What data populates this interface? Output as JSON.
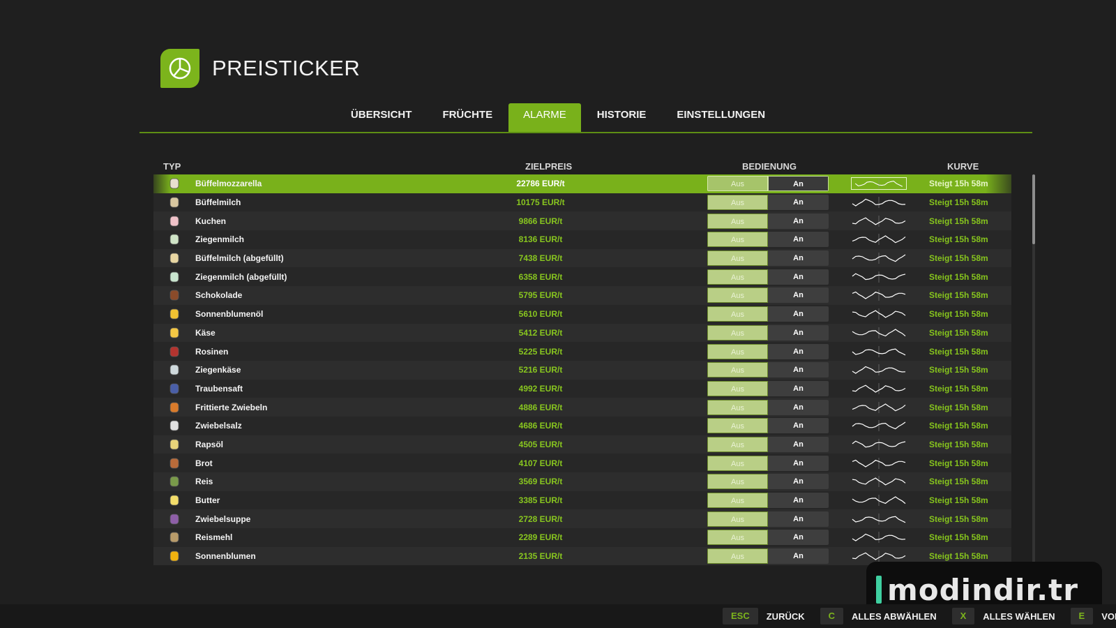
{
  "app": {
    "title": "PREISTICKER",
    "logo_icon": "pie-chart-icon",
    "accent": "#7cb41c"
  },
  "tabs": [
    {
      "label": "ÜBERSICHT",
      "active": false
    },
    {
      "label": "FRÜCHTE",
      "active": false
    },
    {
      "label": "ALARME",
      "active": true
    },
    {
      "label": "HISTORIE",
      "active": false
    },
    {
      "label": "EINSTELLUNGEN",
      "active": false
    }
  ],
  "columns": {
    "type": "TYP",
    "target": "ZIELPREIS",
    "control": "BEDIENUNG",
    "curve": "KURVE"
  },
  "rows": [
    {
      "icon": "mozzarella-icon",
      "name": "Büffelmozzarella",
      "price": "22786 EUR/t",
      "off": "Aus",
      "on": "An",
      "status": "Steigt 15h 58m",
      "selected": true
    },
    {
      "icon": "milk-bottle-icon",
      "name": "Büffelmilch",
      "price": "10175 EUR/t",
      "off": "Aus",
      "on": "An",
      "status": "Steigt 15h 58m"
    },
    {
      "icon": "cake-icon",
      "name": "Kuchen",
      "price": "9866 EUR/t",
      "off": "Aus",
      "on": "An",
      "status": "Steigt 15h 58m"
    },
    {
      "icon": "milk-bottle-icon",
      "name": "Ziegenmilch",
      "price": "8136 EUR/t",
      "off": "Aus",
      "on": "An",
      "status": "Steigt 15h 58m"
    },
    {
      "icon": "bottle-icon",
      "name": "Büffelmilch (abgefüllt)",
      "price": "7438 EUR/t",
      "off": "Aus",
      "on": "An",
      "status": "Steigt 15h 58m"
    },
    {
      "icon": "bottle-icon",
      "name": "Ziegenmilch (abgefüllt)",
      "price": "6358 EUR/t",
      "off": "Aus",
      "on": "An",
      "status": "Steigt 15h 58m"
    },
    {
      "icon": "chocolate-icon",
      "name": "Schokolade",
      "price": "5795 EUR/t",
      "off": "Aus",
      "on": "An",
      "status": "Steigt 15h 58m"
    },
    {
      "icon": "oil-can-icon",
      "name": "Sonnenblumenöl",
      "price": "5610 EUR/t",
      "off": "Aus",
      "on": "An",
      "status": "Steigt 15h 58m"
    },
    {
      "icon": "cheese-icon",
      "name": "Käse",
      "price": "5412 EUR/t",
      "off": "Aus",
      "on": "An",
      "status": "Steigt 15h 58m"
    },
    {
      "icon": "raisins-icon",
      "name": "Rosinen",
      "price": "5225 EUR/t",
      "off": "Aus",
      "on": "An",
      "status": "Steigt 15h 58m"
    },
    {
      "icon": "goat-cheese-icon",
      "name": "Ziegenkäse",
      "price": "5216 EUR/t",
      "off": "Aus",
      "on": "An",
      "status": "Steigt 15h 58m"
    },
    {
      "icon": "juice-icon",
      "name": "Traubensaft",
      "price": "4992 EUR/t",
      "off": "Aus",
      "on": "An",
      "status": "Steigt 15h 58m"
    },
    {
      "icon": "onion-rings-icon",
      "name": "Frittierte Zwiebeln",
      "price": "4886 EUR/t",
      "off": "Aus",
      "on": "An",
      "status": "Steigt 15h 58m"
    },
    {
      "icon": "salt-icon",
      "name": "Zwiebelsalz",
      "price": "4686 EUR/t",
      "off": "Aus",
      "on": "An",
      "status": "Steigt 15h 58m"
    },
    {
      "icon": "oil-can-icon",
      "name": "Rapsöl",
      "price": "4505 EUR/t",
      "off": "Aus",
      "on": "An",
      "status": "Steigt 15h 58m"
    },
    {
      "icon": "bread-icon",
      "name": "Brot",
      "price": "4107 EUR/t",
      "off": "Aus",
      "on": "An",
      "status": "Steigt 15h 58m"
    },
    {
      "icon": "rice-icon",
      "name": "Reis",
      "price": "3569 EUR/t",
      "off": "Aus",
      "on": "An",
      "status": "Steigt 15h 58m"
    },
    {
      "icon": "butter-icon",
      "name": "Butter",
      "price": "3385 EUR/t",
      "off": "Aus",
      "on": "An",
      "status": "Steigt 15h 58m"
    },
    {
      "icon": "soup-can-icon",
      "name": "Zwiebelsuppe",
      "price": "2728 EUR/t",
      "off": "Aus",
      "on": "An",
      "status": "Steigt 15h 58m"
    },
    {
      "icon": "flour-bag-icon",
      "name": "Reismehl",
      "price": "2289 EUR/t",
      "off": "Aus",
      "on": "An",
      "status": "Steigt 15h 58m"
    },
    {
      "icon": "sunflower-icon",
      "name": "Sonnenblumen",
      "price": "2135 EUR/t",
      "off": "Aus",
      "on": "An",
      "status": "Steigt 15h 58m"
    }
  ],
  "watermark": {
    "text": "modindir.tr"
  },
  "footer": {
    "hints": [
      {
        "key": "ESC",
        "label": "ZURÜCK"
      },
      {
        "key": "C",
        "label": "ALLES ABWÄHLEN"
      },
      {
        "key": "X",
        "label": "ALLES WÄHLEN"
      },
      {
        "key": "E",
        "label": "VORH"
      }
    ]
  }
}
